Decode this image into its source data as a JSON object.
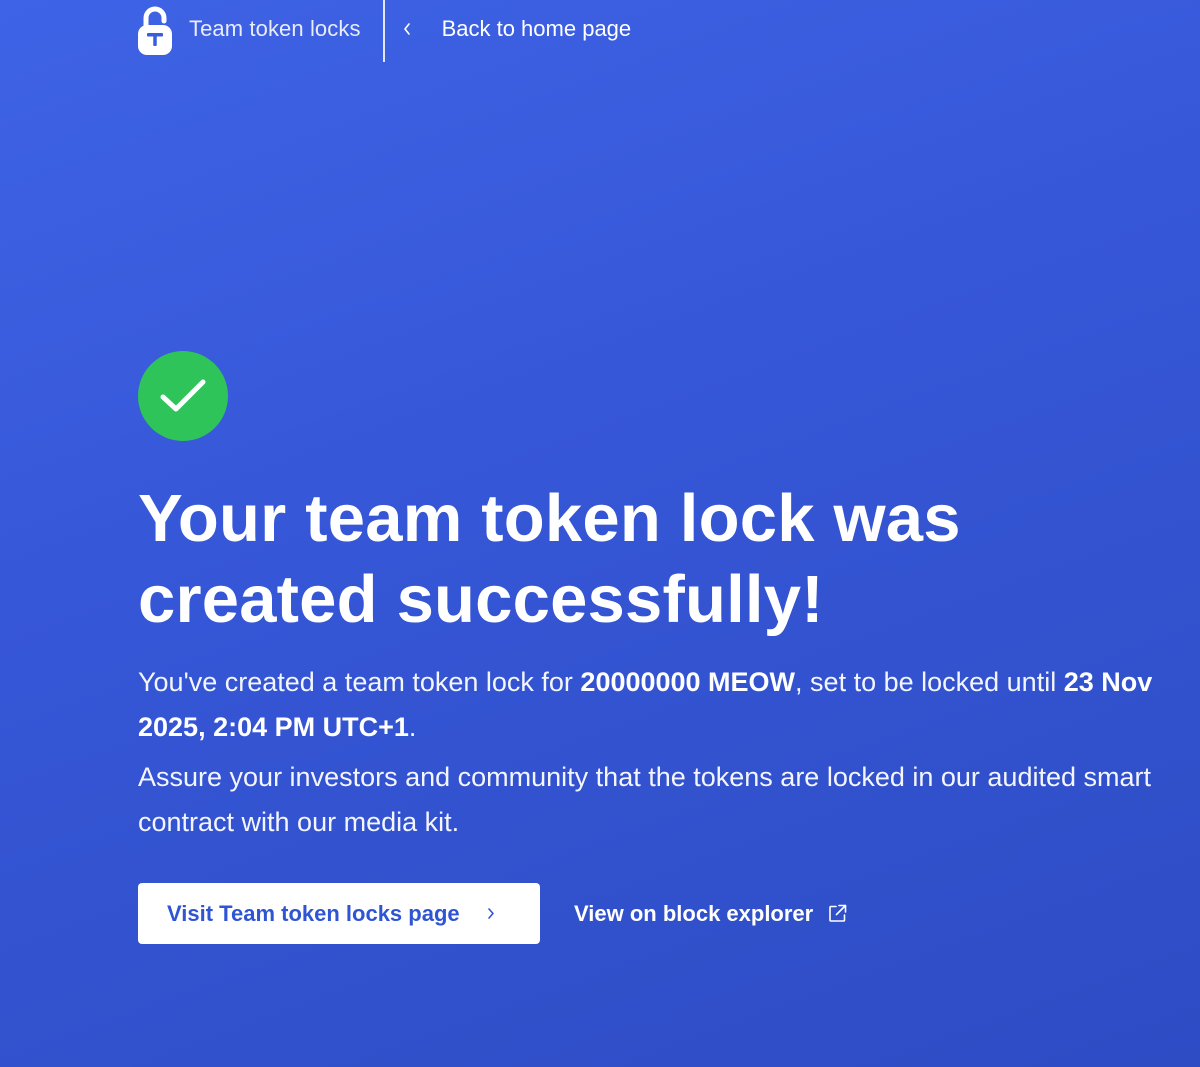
{
  "header": {
    "brand_name": "Team token locks",
    "brand_icon": "padlock-icon",
    "back_label": "Back to home page",
    "back_icon": "chevron-left-icon"
  },
  "status_icon": "checkmark-icon",
  "headline": {
    "line1": "Your team token lock was",
    "line2": "created successfully!"
  },
  "summary": {
    "intro": "You've created a team token lock for ",
    "amount": "20000000 MEOW",
    "middle": ", set to be locked until ",
    "unlock_date": "23 Nov 2025, 2:04 PM UTC+1",
    "end": "."
  },
  "assurance_text": "Assure your investors and community that the tokens are locked in our audited smart contract with our media kit.",
  "actions": {
    "primary_label": "Visit Team token locks page",
    "primary_icon": "chevron-right-icon",
    "secondary_label": "View on block explorer",
    "secondary_icon": "external-link-icon"
  },
  "colors": {
    "background": "#3556d6",
    "success": "#2ec45a",
    "primary_text": "#2f55d4"
  }
}
